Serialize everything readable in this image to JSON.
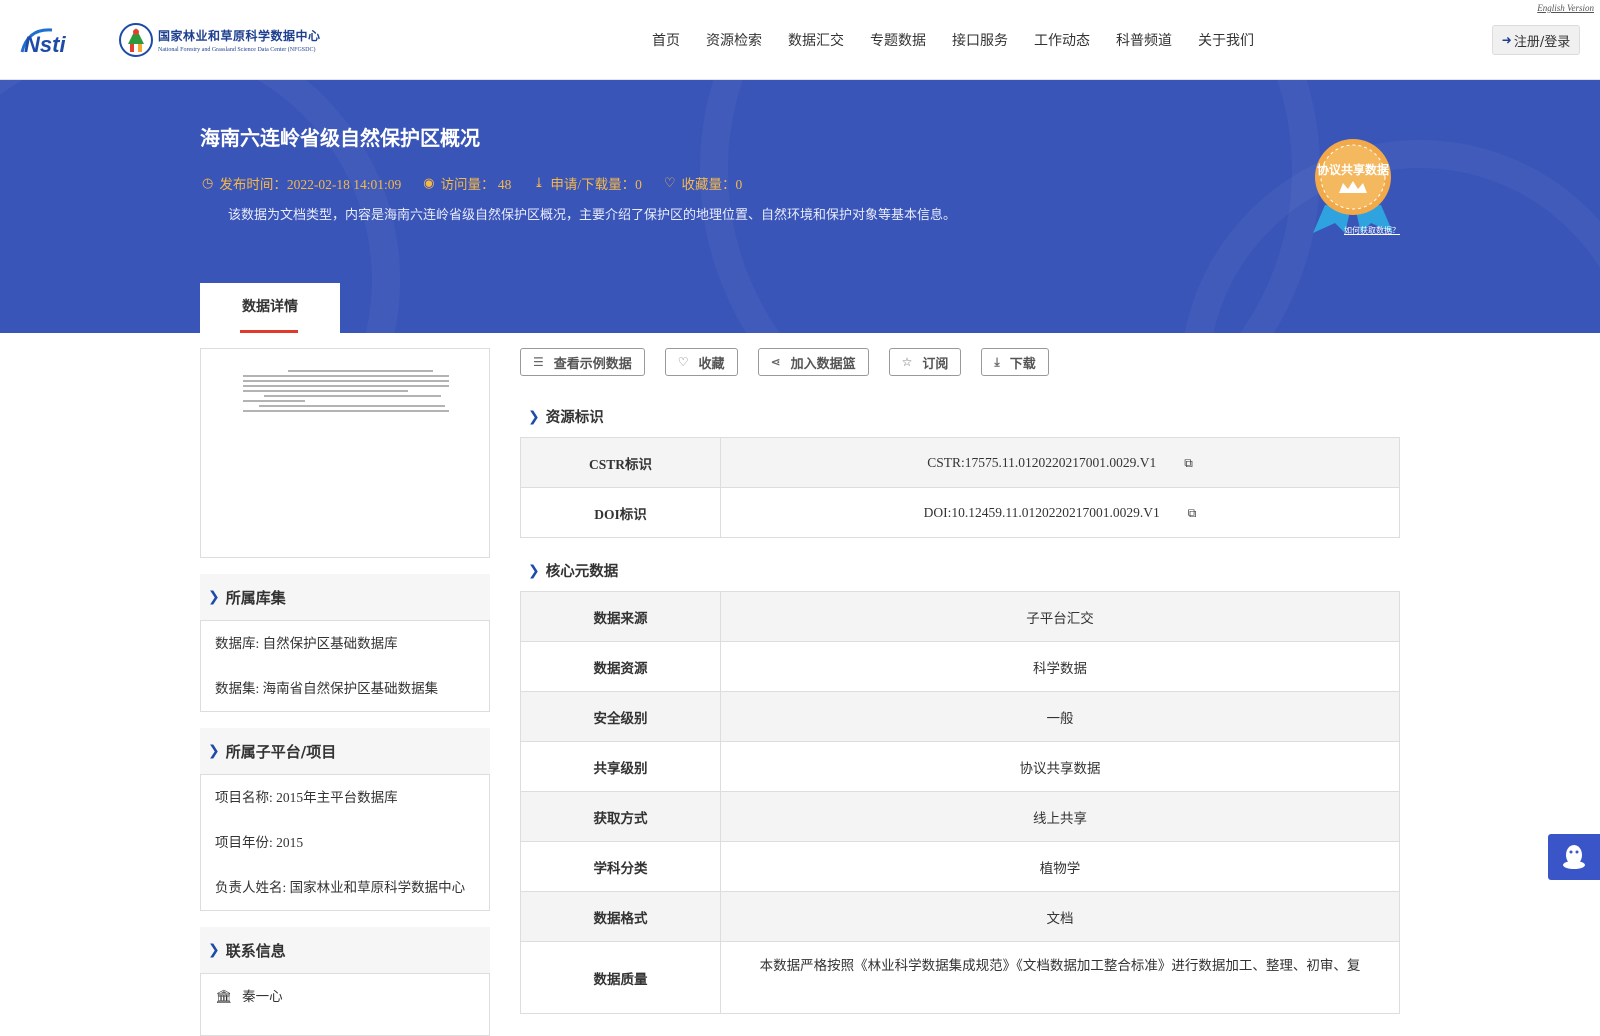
{
  "header": {
    "english_link": "English Version",
    "logo_center_cn": "国家林业和草原科学数据中心",
    "logo_center_en": "National Forestry and Grassland Science Data Center (NFGSDC)",
    "nav": [
      "首页",
      "资源检索",
      "数据汇交",
      "专题数据",
      "接口服务",
      "工作动态",
      "科普频道",
      "关于我们"
    ],
    "login_label": "注册/登录"
  },
  "banner": {
    "title": "海南六连岭省级自然保护区概况",
    "publish_time": "发布时间：2022-02-18 14:01:09",
    "visits": "访问量： 48",
    "downloads": "申请/下载量：0",
    "favorites": "收藏量：0",
    "description": "该数据为文档类型，内容是海南六连岭省级自然保护区概况，主要介绍了保护区的地理位置、自然环境和保护对象等基本信息。",
    "badge_text": "协议共享数据",
    "how_link": "如何获取数据？",
    "tab": "数据详情"
  },
  "left": {
    "library": {
      "heading": "所属库集",
      "rows": [
        "数据库: 自然保护区基础数据库",
        "数据集: 海南省自然保护区基础数据集"
      ]
    },
    "project": {
      "heading": "所属子平台/项目",
      "rows": [
        "项目名称: 2015年主平台数据库",
        "项目年份: 2015",
        "负责人姓名: 国家林业和草原科学数据中心"
      ]
    },
    "contact": {
      "heading": "联系信息",
      "name": "秦一心"
    }
  },
  "actions": [
    "查看示例数据",
    "收藏",
    "加入数据篮",
    "订阅",
    "下载"
  ],
  "resource_id": {
    "heading": "资源标识",
    "rows": [
      {
        "key": "CSTR标识",
        "value": "CSTR:17575.11.0120220217001.0029.V1"
      },
      {
        "key": "DOI标识",
        "value": "DOI:10.12459.11.0120220217001.0029.V1"
      }
    ]
  },
  "core_meta": {
    "heading": "核心元数据",
    "rows": [
      {
        "key": "数据来源",
        "value": "子平台汇交"
      },
      {
        "key": "数据资源",
        "value": "科学数据"
      },
      {
        "key": "安全级别",
        "value": "一般"
      },
      {
        "key": "共享级别",
        "value": "协议共享数据"
      },
      {
        "key": "获取方式",
        "value": "线上共享"
      },
      {
        "key": "学科分类",
        "value": "植物学"
      },
      {
        "key": "数据格式",
        "value": "文档"
      },
      {
        "key": "数据质量",
        "value": "本数据严格按照《林业科学数据集成规范》《文档数据加工整合标准》进行数据加工、整理、初审、复"
      }
    ]
  },
  "colors": {
    "banner": "#3a55b8",
    "accent_orange": "#f5b94a",
    "tab_underline": "#e03a2a",
    "chevron": "#1e4aa8"
  }
}
